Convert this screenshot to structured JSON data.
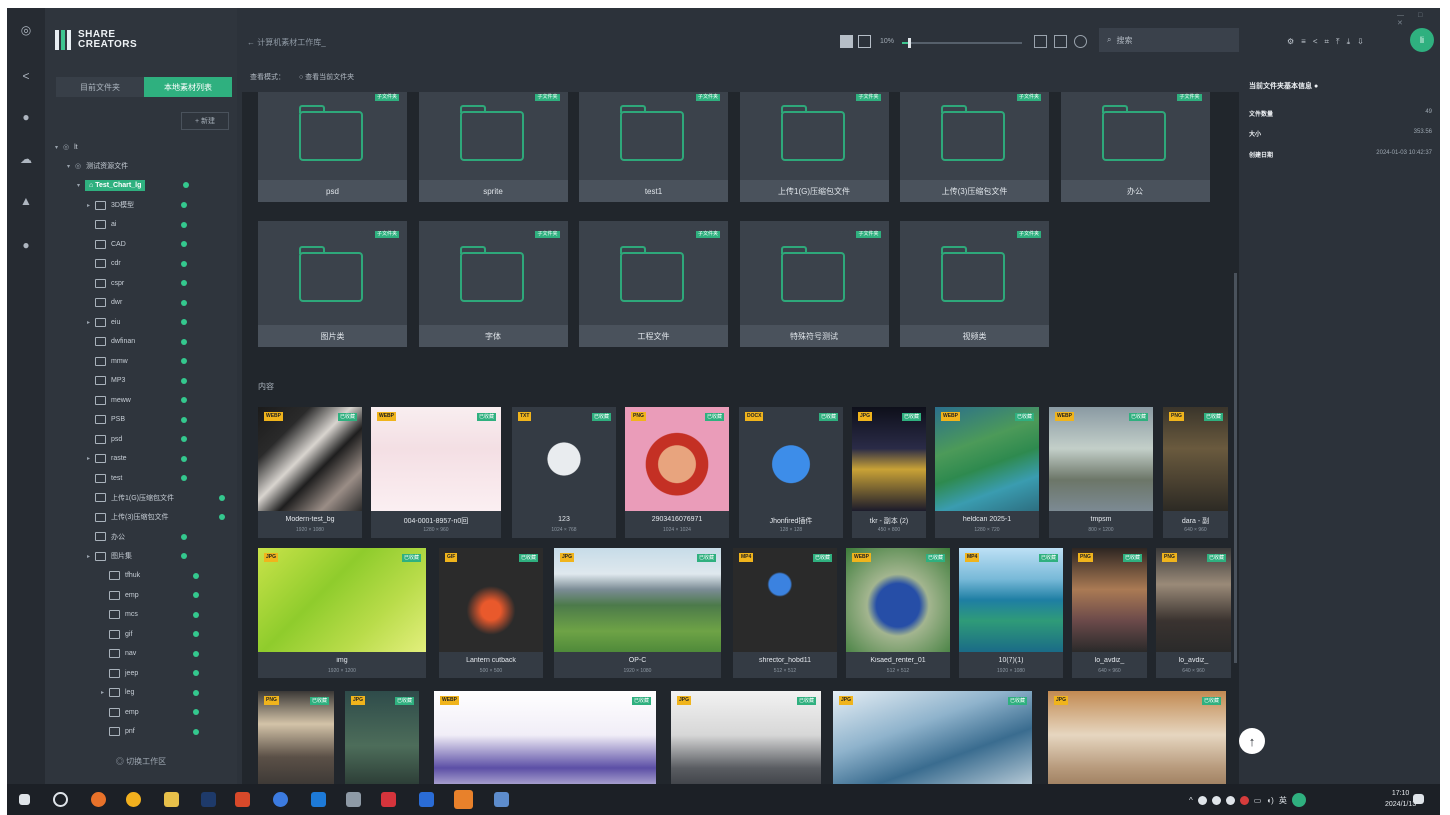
{
  "app": {
    "logo_line1": "SHARE",
    "logo_line2": "CREATORS",
    "window_controls": "— □ ✕"
  },
  "sidebar": {
    "tabs": [
      {
        "label": "目前文件夹"
      },
      {
        "label": "本地素材列表"
      }
    ],
    "new_button": "+ 新建",
    "root_label": "lt",
    "parent_label": "测试资源文件",
    "selected_label": "Test_Chart_lg",
    "tree_items": [
      {
        "label": "3D模型",
        "expandable": true
      },
      {
        "label": "ai"
      },
      {
        "label": "CAD"
      },
      {
        "label": "cdr"
      },
      {
        "label": "cspr"
      },
      {
        "label": "dwr"
      },
      {
        "label": "eiu",
        "expandable": true
      },
      {
        "label": "dwfinan"
      },
      {
        "label": "mmw"
      },
      {
        "label": "MP3"
      },
      {
        "label": "meww"
      },
      {
        "label": "PSB"
      },
      {
        "label": "psd"
      },
      {
        "label": "raste",
        "expandable": true
      },
      {
        "label": "test"
      },
      {
        "label": "上传1(G)压缩包文件"
      },
      {
        "label": "上传(3)压缩包文件"
      },
      {
        "label": "办公"
      },
      {
        "label": "图片集",
        "expandable": true
      }
    ],
    "sub_items": [
      {
        "label": "tfhuk"
      },
      {
        "label": "emp"
      },
      {
        "label": "mcs"
      },
      {
        "label": "gif"
      },
      {
        "label": "nav"
      },
      {
        "label": "jeep"
      },
      {
        "label": "leg",
        "expandable": true
      },
      {
        "label": "emp"
      },
      {
        "label": "pnf"
      }
    ],
    "footer": "◎ 切换工作区"
  },
  "topbar": {
    "breadcrumb": "← 计算机素材工作库_",
    "zoom_label": "10%",
    "zoom_value": 0.05,
    "search_placeholder": "搜索"
  },
  "subbar": {
    "filter1": "查看模式：",
    "filter2": "○ 查看当前文件夹"
  },
  "folders": [
    {
      "name": "psd"
    },
    {
      "name": "sprite"
    },
    {
      "name": "test1"
    },
    {
      "name": "上传1(G)压缩包文件"
    },
    {
      "name": "上传(3)压缩包文件"
    },
    {
      "name": "办公"
    },
    {
      "name": "图片类"
    },
    {
      "name": "字体"
    },
    {
      "name": "工程文件"
    },
    {
      "name": "特殊符号测试"
    },
    {
      "name": "视频类"
    }
  ],
  "folder_tag": "子文件夹",
  "section_label": "内容",
  "status_tag": "已收藏",
  "cards_row1": [
    {
      "name": "Modern-test_bg",
      "dim": "1920 × 1080",
      "ftype": "WEBP"
    },
    {
      "name": "004-0001-8957-n0回",
      "dim": "1280 × 960",
      "ftype": "WEBP"
    },
    {
      "name": "123",
      "dim": "1024 × 768",
      "ftype": "TXT"
    },
    {
      "name": "2903416076971",
      "dim": "1024 × 1024",
      "ftype": "PNG"
    },
    {
      "name": "Jhonfired插件",
      "dim": "128 × 128",
      "ftype": "DOCX"
    },
    {
      "name": "tkr - 副本 (2)",
      "dim": "450 × 800",
      "ftype": "JPG"
    },
    {
      "name": "heldcan 2025-1",
      "dim": "1280 × 720",
      "ftype": "WEBP"
    },
    {
      "name": "tmpsm",
      "dim": "800 × 1200",
      "ftype": "WEBP"
    },
    {
      "name": "dara - 副",
      "dim": "640 × 960",
      "ftype": "PNG"
    }
  ],
  "cards_row2": [
    {
      "name": "img",
      "dim": "1920 × 1200",
      "ftype": "JPG"
    },
    {
      "name": "Lantern cutback",
      "dim": "500 × 500",
      "ftype": "GIF"
    },
    {
      "name": "OP-C",
      "dim": "1920 × 1080",
      "ftype": "JPG"
    },
    {
      "name": "shrector_hobd11",
      "dim": "512 × 512",
      "ftype": "MP4"
    },
    {
      "name": "Kisaed_renter_01",
      "dim": "512 × 512",
      "ftype": "WEBP"
    },
    {
      "name": "10(7)(1)",
      "dim": "1920 × 1080",
      "ftype": "MP4"
    },
    {
      "name": "lo_avdiz_",
      "dim": "640 × 960",
      "ftype": "PNG"
    },
    {
      "name": "lo_avdiz_",
      "dim": "640 × 960",
      "ftype": "PNG"
    }
  ],
  "cards_row3": [
    {
      "ftype": "PNG"
    },
    {
      "ftype": "JPG"
    },
    {
      "ftype": "WEBP"
    },
    {
      "ftype": "JPG"
    },
    {
      "ftype": "JPG"
    },
    {
      "ftype": "JPG"
    }
  ],
  "details": {
    "title": "当前文件夹基本信息 ●",
    "rows": [
      {
        "k": "文件数量",
        "v": "49"
      },
      {
        "k": "大小",
        "v": "353.56"
      },
      {
        "k": "创建日期",
        "v": "2024-01-03 10:42:37"
      }
    ],
    "avatar": "li"
  },
  "taskbar": {
    "time": "17:10",
    "date": "2024/1/13",
    "lang": "英"
  },
  "colors": {
    "accent": "#2fb07f",
    "file_tag": "#f0b41c",
    "bg": "#2c323a"
  }
}
